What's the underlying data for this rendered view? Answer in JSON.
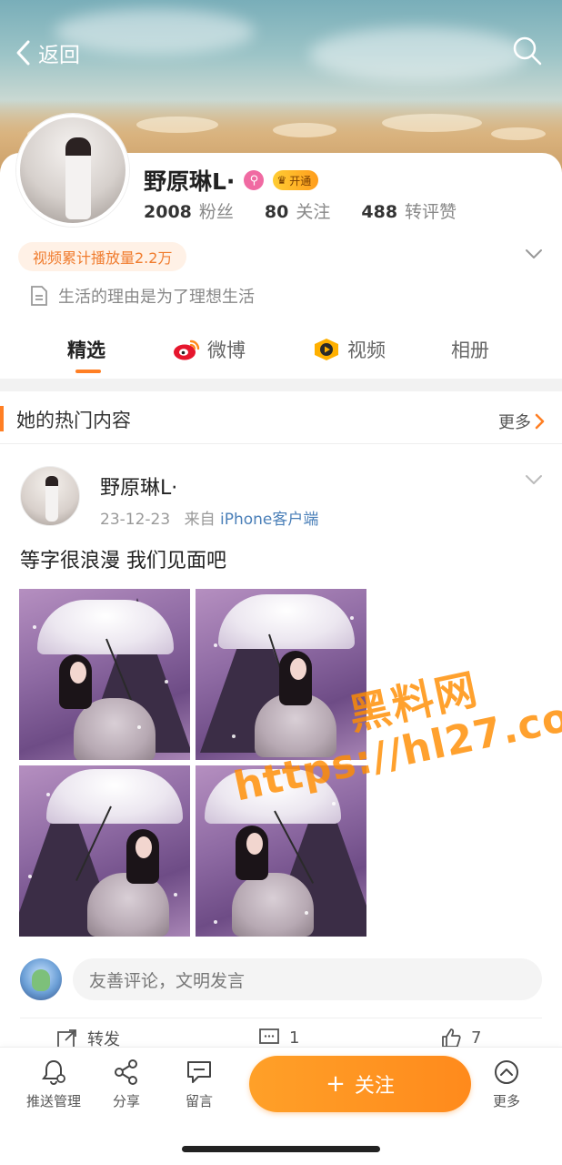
{
  "header": {
    "back_label": "返回"
  },
  "profile": {
    "name": "野原琳L·",
    "vip_label": "开通",
    "stats": [
      {
        "value": "2008",
        "label": "粉丝"
      },
      {
        "value": "80",
        "label": "关注"
      },
      {
        "value": "488",
        "label": "转评赞"
      }
    ],
    "play_count": "视频累计播放量2.2万",
    "bio": "生活的理由是为了理想生活"
  },
  "tabs": [
    {
      "label": "精选",
      "active": true
    },
    {
      "label": "微博",
      "active": false
    },
    {
      "label": "视频",
      "active": false
    },
    {
      "label": "相册",
      "active": false
    }
  ],
  "hot_section": {
    "title": "她的热门内容",
    "more_label": "更多"
  },
  "post": {
    "author": "野原琳L·",
    "date": "23-12-23",
    "source_prefix": "来自",
    "source": "iPhone客户端",
    "text": "等字很浪漫 我们见面吧",
    "photo_count": 4
  },
  "watermark": {
    "line1": "黑料网",
    "line2": "https://hl27.co"
  },
  "comment": {
    "placeholder": "友善评论，文明发言"
  },
  "actions": {
    "repost_label": "转发",
    "comment_count": "1",
    "like_count": "7"
  },
  "bottom_bar": {
    "push_label": "推送管理",
    "share_label": "分享",
    "message_label": "留言",
    "follow_label": "关注",
    "more_label": "更多"
  },
  "colors": {
    "accent": "#ff8a1c",
    "link": "#4a7fb8",
    "pill_bg": "#fff1e6",
    "pill_text": "#f07c2e"
  }
}
